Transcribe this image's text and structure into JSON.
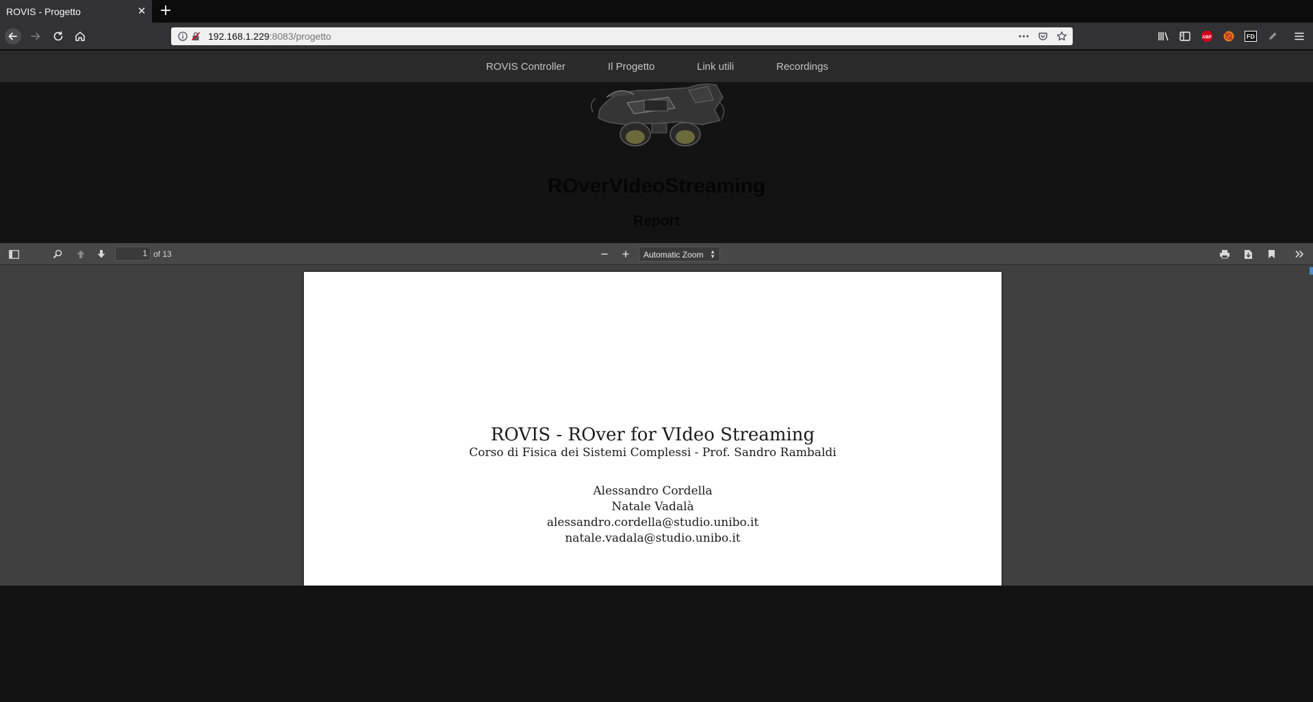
{
  "browser": {
    "tab_title": "ROVIS - Progetto",
    "tab_close": "✕",
    "new_tab": "+",
    "url_host": "192.168.1.229",
    "url_rest": ":8083/progetto",
    "url_more": "•••"
  },
  "site_nav": {
    "items": [
      "ROVIS Controller",
      "Il Progetto",
      "Link utili",
      "Recordings"
    ]
  },
  "hero": {
    "title": "ROverVIdeoStreaming",
    "subtitle": "Report"
  },
  "pdf_viewer": {
    "page_number": "1",
    "page_count": "of 13",
    "zoom": "Automatic Zoom"
  },
  "pdf_page": {
    "title": "ROVIS - ROver for VIdeo Streaming",
    "course": "Corso di Fisica dei Sistemi Complessi - Prof. Sandro Rambaldi",
    "authors": [
      "Alessandro Cordella",
      "Natale Vadalà",
      "alessandro.cordella@studio.unibo.it",
      "natale.vadala@studio.unibo.it"
    ]
  },
  "colors": {
    "chrome_dark": "#0c0c0d",
    "chrome_toolbar": "#323234",
    "page_bg": "#131313",
    "pdf_bg": "#404040"
  }
}
